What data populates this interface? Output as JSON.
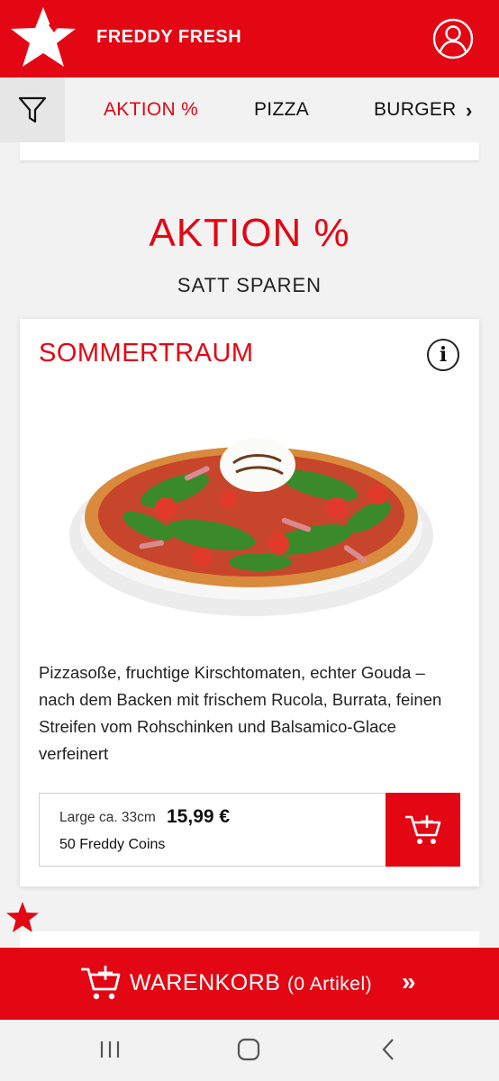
{
  "header": {
    "brand": "FREDDY  FRESH",
    "logo_icon": "star-logo-icon",
    "account_icon": "user-icon"
  },
  "categories": {
    "filter_icon": "filter-icon",
    "items": [
      {
        "label": "AKTION %",
        "active": true
      },
      {
        "label": "PIZZA",
        "active": false
      },
      {
        "label": "BURGER",
        "active": false
      }
    ],
    "more": "›"
  },
  "section": {
    "title": "AKTION %",
    "subtitle": "SATT SPAREN"
  },
  "product": {
    "name": "SOMMERTRAUM",
    "info_label": "i",
    "description": "Pizzasoße, fruchtige Kirschtomaten, echter Gouda – nach dem Backen mit frischem Rucola, Burrata, feinen Streifen vom Rohschinken und Balsamico-Glace verfeinert",
    "size": "Large ca. 33cm",
    "price": "15,99 €",
    "coins": "50 Freddy Coins"
  },
  "cart": {
    "label": "WARENKORB",
    "count": "(0 Artikel)",
    "arrow": "»"
  },
  "colors": {
    "brand_red": "#e30613",
    "background": "#f2f2f2"
  }
}
